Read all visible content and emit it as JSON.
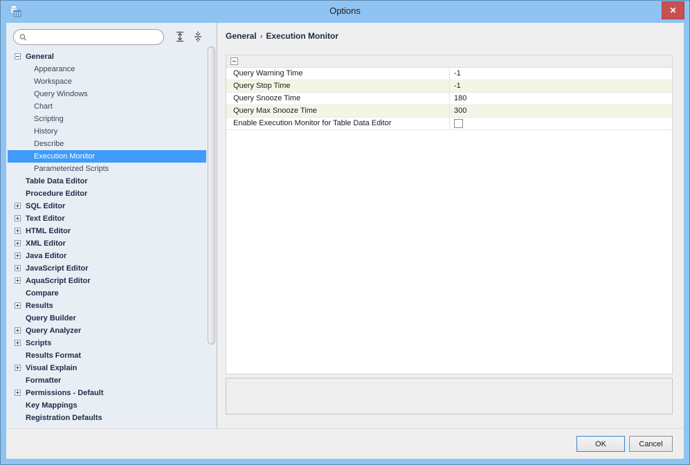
{
  "window": {
    "title": "Options"
  },
  "icons": {
    "app": "database-grid-icon",
    "close_glyph": "✕",
    "search": "magnifier-icon",
    "expand_all": "expand-all-icon",
    "collapse_all": "collapse-all-icon"
  },
  "search": {
    "value": "",
    "placeholder": ""
  },
  "sidebar": {
    "items": [
      {
        "label": "General",
        "level": 0,
        "bold": true,
        "toggle": "minus"
      },
      {
        "label": "Appearance",
        "level": 1
      },
      {
        "label": "Workspace",
        "level": 1
      },
      {
        "label": "Query Windows",
        "level": 1
      },
      {
        "label": "Chart",
        "level": 1
      },
      {
        "label": "Scripting",
        "level": 1
      },
      {
        "label": "History",
        "level": 1
      },
      {
        "label": "Describe",
        "level": 1
      },
      {
        "label": "Execution Monitor",
        "level": 1,
        "selected": true
      },
      {
        "label": "Parameterized Scripts",
        "level": 1
      },
      {
        "label": "Table Data Editor",
        "level": 0,
        "bold": true
      },
      {
        "label": "Procedure Editor",
        "level": 0,
        "bold": true
      },
      {
        "label": "SQL Editor",
        "level": 0,
        "bold": true,
        "toggle": "plus"
      },
      {
        "label": "Text Editor",
        "level": 0,
        "bold": true,
        "toggle": "plus"
      },
      {
        "label": "HTML Editor",
        "level": 0,
        "bold": true,
        "toggle": "plus"
      },
      {
        "label": "XML Editor",
        "level": 0,
        "bold": true,
        "toggle": "plus"
      },
      {
        "label": "Java Editor",
        "level": 0,
        "bold": true,
        "toggle": "plus"
      },
      {
        "label": "JavaScript Editor",
        "level": 0,
        "bold": true,
        "toggle": "plus"
      },
      {
        "label": "AquaScript Editor",
        "level": 0,
        "bold": true,
        "toggle": "plus"
      },
      {
        "label": "Compare",
        "level": 0,
        "bold": true
      },
      {
        "label": "Results",
        "level": 0,
        "bold": true,
        "toggle": "plus"
      },
      {
        "label": "Query Builder",
        "level": 0,
        "bold": true
      },
      {
        "label": "Query Analyzer",
        "level": 0,
        "bold": true,
        "toggle": "plus"
      },
      {
        "label": "Scripts",
        "level": 0,
        "bold": true,
        "toggle": "plus"
      },
      {
        "label": "Results Format",
        "level": 0,
        "bold": true
      },
      {
        "label": "Visual Explain",
        "level": 0,
        "bold": true,
        "toggle": "plus"
      },
      {
        "label": "Formatter",
        "level": 0,
        "bold": true
      },
      {
        "label": "Permissions - Default",
        "level": 0,
        "bold": true,
        "toggle": "plus"
      },
      {
        "label": "Key Mappings",
        "level": 0,
        "bold": true
      },
      {
        "label": "Registration Defaults",
        "level": 0,
        "bold": true
      }
    ]
  },
  "breadcrumb": {
    "parts": [
      "General",
      "Execution Monitor"
    ],
    "separator": "›"
  },
  "settings": {
    "rows": [
      {
        "label": "Query Warning Time",
        "value": "-1",
        "type": "text"
      },
      {
        "label": "Query Stop Time",
        "value": "-1",
        "type": "text"
      },
      {
        "label": "Query Snooze Time",
        "value": "180",
        "type": "text"
      },
      {
        "label": "Query Max Snooze Time",
        "value": "300",
        "type": "text"
      },
      {
        "label": "Enable Execution Monitor for Table Data Editor",
        "type": "checkbox",
        "checked": false
      }
    ]
  },
  "footer": {
    "ok_label": "OK",
    "cancel_label": "Cancel"
  },
  "colors": {
    "titlebar": "#8fc3f1",
    "close_button": "#c75050",
    "selection": "#3f9bfc",
    "row_stripe": "#f5f5e6",
    "sidebar_bg": "#e9eef5",
    "panel_bg": "#efefef",
    "ok_border": "#3c83c8"
  }
}
